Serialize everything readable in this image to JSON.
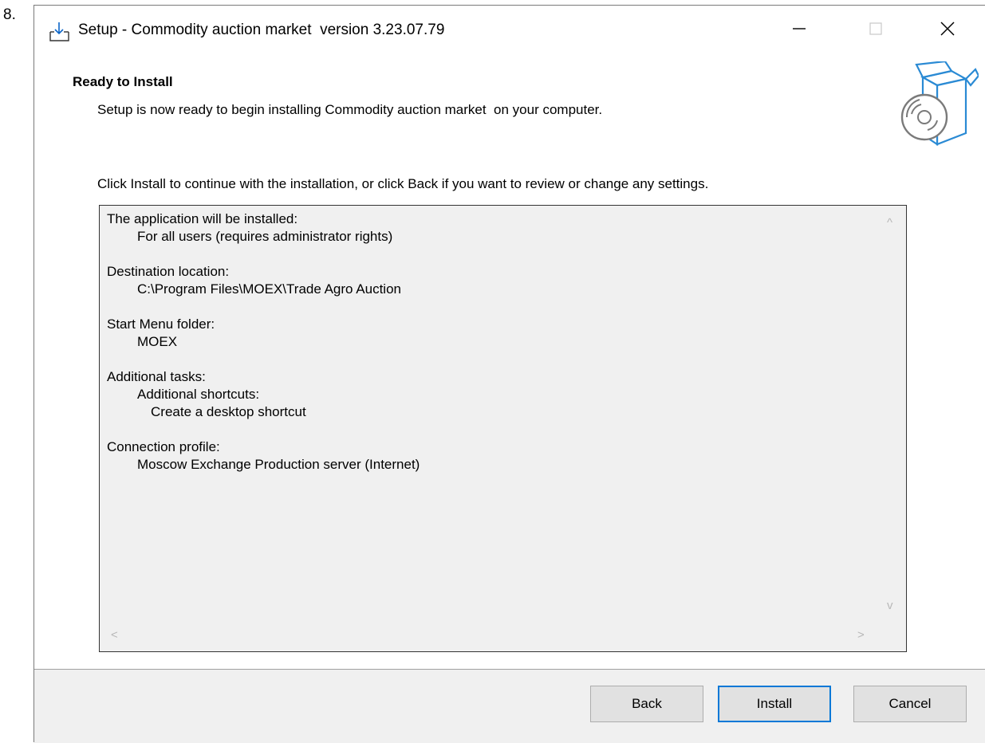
{
  "outer_label": "8.",
  "window": {
    "title": "Setup - Commodity auction market  version 3.23.07.79",
    "app_icon": "download-tray-icon",
    "controls": {
      "minimize_icon": "minimize-icon",
      "maximize_icon": "maximize-icon",
      "close_icon": "close-icon"
    }
  },
  "header": {
    "title": "Ready to Install",
    "subtitle": "Setup is now ready to begin installing Commodity auction market  on your computer.",
    "icon": "software-box-disc-icon"
  },
  "instruction": "Click Install to continue with the installation, or click Back if you want to review or change any settings.",
  "memo": {
    "sections": [
      {
        "heading": "The application will be installed:",
        "lines": [
          "For all users (requires administrator rights)"
        ]
      },
      {
        "heading": "Destination location:",
        "lines": [
          "C:\\Program Files\\MOEX\\Trade Agro Auction"
        ]
      },
      {
        "heading": "Start Menu folder:",
        "lines": [
          "MOEX"
        ]
      },
      {
        "heading": "Additional tasks:",
        "lines": [
          "Additional shortcuts:"
        ],
        "sublines": [
          "Create a desktop shortcut"
        ]
      },
      {
        "heading": "Connection profile:",
        "lines": [
          "Moscow Exchange Production server (Internet)"
        ]
      }
    ],
    "scroll_up": "^",
    "scroll_down": "v",
    "scroll_left": "<",
    "scroll_right": ">"
  },
  "buttons": {
    "back": "Back",
    "install": "Install",
    "cancel": "Cancel"
  },
  "colors": {
    "accent": "#0078d7",
    "footer_bg": "#f0f0f0",
    "button_bg": "#e1e1e1"
  }
}
